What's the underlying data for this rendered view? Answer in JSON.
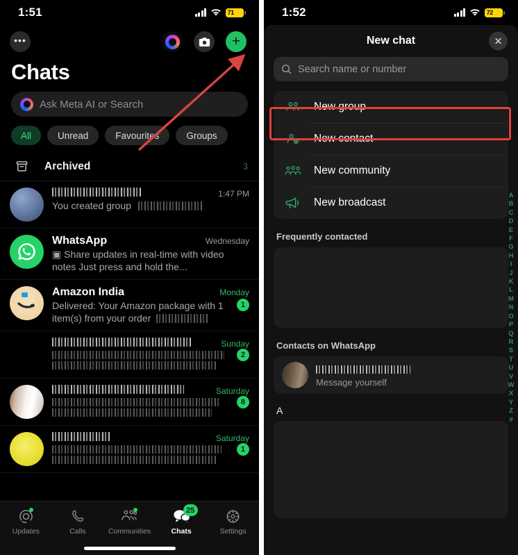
{
  "left": {
    "status": {
      "time": "1:51",
      "battery": "71",
      "charging_glyph": "⚡",
      "signal_icon": "cellular-bars-icon",
      "wifi_icon": "wifi-icon"
    },
    "header": {
      "menu_label": "•••",
      "meta_ai_icon": "meta-ai-icon",
      "camera_icon": "camera-icon",
      "new_chat_label": "+"
    },
    "title": "Chats",
    "search": {
      "placeholder": "Ask Meta AI or Search",
      "icon": "meta-ai-icon"
    },
    "filters": [
      {
        "label": "All",
        "active": true
      },
      {
        "label": "Unread",
        "active": false
      },
      {
        "label": "Favourites",
        "active": false
      },
      {
        "label": "Groups",
        "active": false
      }
    ],
    "archived": {
      "icon": "archive-box-icon",
      "label": "Archived",
      "count": "3"
    },
    "chats": [
      {
        "name": "",
        "name_redacted": true,
        "snippet": "You created group",
        "snippet_redacted": true,
        "time": "1:47 PM",
        "time_green": false,
        "badge": "",
        "avatar": "av-blue"
      },
      {
        "name": "WhatsApp",
        "name_redacted": false,
        "snippet": "▣ Share updates in real-time with video notes Just press and hold the...",
        "snippet_redacted": false,
        "time": "Wednesday",
        "time_green": false,
        "badge": "",
        "avatar": "av-wa"
      },
      {
        "name": "Amazon India",
        "name_redacted": false,
        "snippet": "Delivered: Your Amazon package with 1 item(s) from your order",
        "snippet_redacted": true,
        "time": "Monday",
        "time_green": true,
        "badge": "1",
        "avatar": "av-amz"
      },
      {
        "name": "",
        "name_redacted": true,
        "snippet": "",
        "snippet_redacted": true,
        "time": "Sunday",
        "time_green": true,
        "badge": "2",
        "avatar": "av-skin1"
      },
      {
        "name": "",
        "name_redacted": true,
        "snippet": "",
        "snippet_redacted": true,
        "time": "Saturday",
        "time_green": true,
        "badge": "8",
        "avatar": "av-skin2"
      },
      {
        "name": "",
        "name_redacted": true,
        "snippet": "",
        "snippet_redacted": true,
        "time": "Saturday",
        "time_green": true,
        "badge": "1",
        "avatar": "av-yellow"
      }
    ],
    "tabs": [
      {
        "label": "Updates",
        "icon": "updates-icon",
        "active": false,
        "dot": true,
        "badge": ""
      },
      {
        "label": "Calls",
        "icon": "phone-icon",
        "active": false,
        "dot": false,
        "badge": ""
      },
      {
        "label": "Communities",
        "icon": "communities-icon",
        "active": false,
        "dot": true,
        "badge": ""
      },
      {
        "label": "Chats",
        "icon": "chats-icon",
        "active": true,
        "dot": false,
        "badge": "25"
      },
      {
        "label": "Settings",
        "icon": "gear-icon",
        "active": false,
        "dot": false,
        "badge": ""
      }
    ]
  },
  "right": {
    "status": {
      "time": "1:52",
      "battery": "72",
      "charging_glyph": "⚡",
      "signal_icon": "cellular-bars-icon",
      "wifi_icon": "wifi-icon"
    },
    "sheet_title": "New chat",
    "close_label": "✕",
    "search": {
      "placeholder": "Search name or number",
      "icon": "search-icon"
    },
    "actions": [
      {
        "label": "New group",
        "icon": "new-group-icon",
        "highlighted": true
      },
      {
        "label": "New contact",
        "icon": "new-contact-icon",
        "highlighted": false
      },
      {
        "label": "New community",
        "icon": "new-community-icon",
        "highlighted": false
      },
      {
        "label": "New broadcast",
        "icon": "new-broadcast-icon",
        "highlighted": false
      }
    ],
    "sections": [
      {
        "title": "Frequently contacted"
      },
      {
        "title": "Contacts on WhatsApp"
      }
    ],
    "self_contact": {
      "name": "",
      "subtitle": "Message yourself"
    },
    "letter_header": "A",
    "alpha_index": [
      "A",
      "B",
      "C",
      "D",
      "E",
      "F",
      "G",
      "H",
      "I",
      "J",
      "K",
      "L",
      "M",
      "N",
      "O",
      "P",
      "Q",
      "R",
      "S",
      "T",
      "U",
      "V",
      "W",
      "X",
      "Y",
      "Z",
      "#"
    ]
  },
  "annotations": {
    "arrow_color": "#e2403c",
    "highlight_color": "#e2403c"
  }
}
